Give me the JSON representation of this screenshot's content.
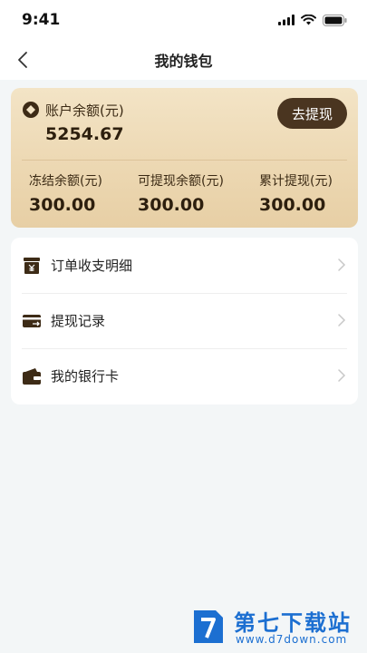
{
  "status": {
    "time": "9:41"
  },
  "nav": {
    "title": "我的钱包"
  },
  "balance": {
    "label": "账户余额(元)",
    "value": "5254.67",
    "withdraw_label": "去提现",
    "stats": [
      {
        "label": "冻结余额(元)",
        "value": "300.00"
      },
      {
        "label": "可提现余额(元)",
        "value": "300.00"
      },
      {
        "label": "累计提现(元)",
        "value": "300.00"
      }
    ]
  },
  "menu": [
    {
      "label": "订单收支明细",
      "icon": "order-ledger-icon"
    },
    {
      "label": "提现记录",
      "icon": "card-transfer-icon"
    },
    {
      "label": "我的银行卡",
      "icon": "wallet-icon"
    }
  ],
  "watermark": {
    "title": "第七下载站",
    "url": "www.d7down.com"
  },
  "colors": {
    "accent": "#4a3520",
    "card_gradient_top": "#f3e4c6",
    "card_gradient_bottom": "#e7cfa5",
    "watermark": "#1c6fd1"
  }
}
